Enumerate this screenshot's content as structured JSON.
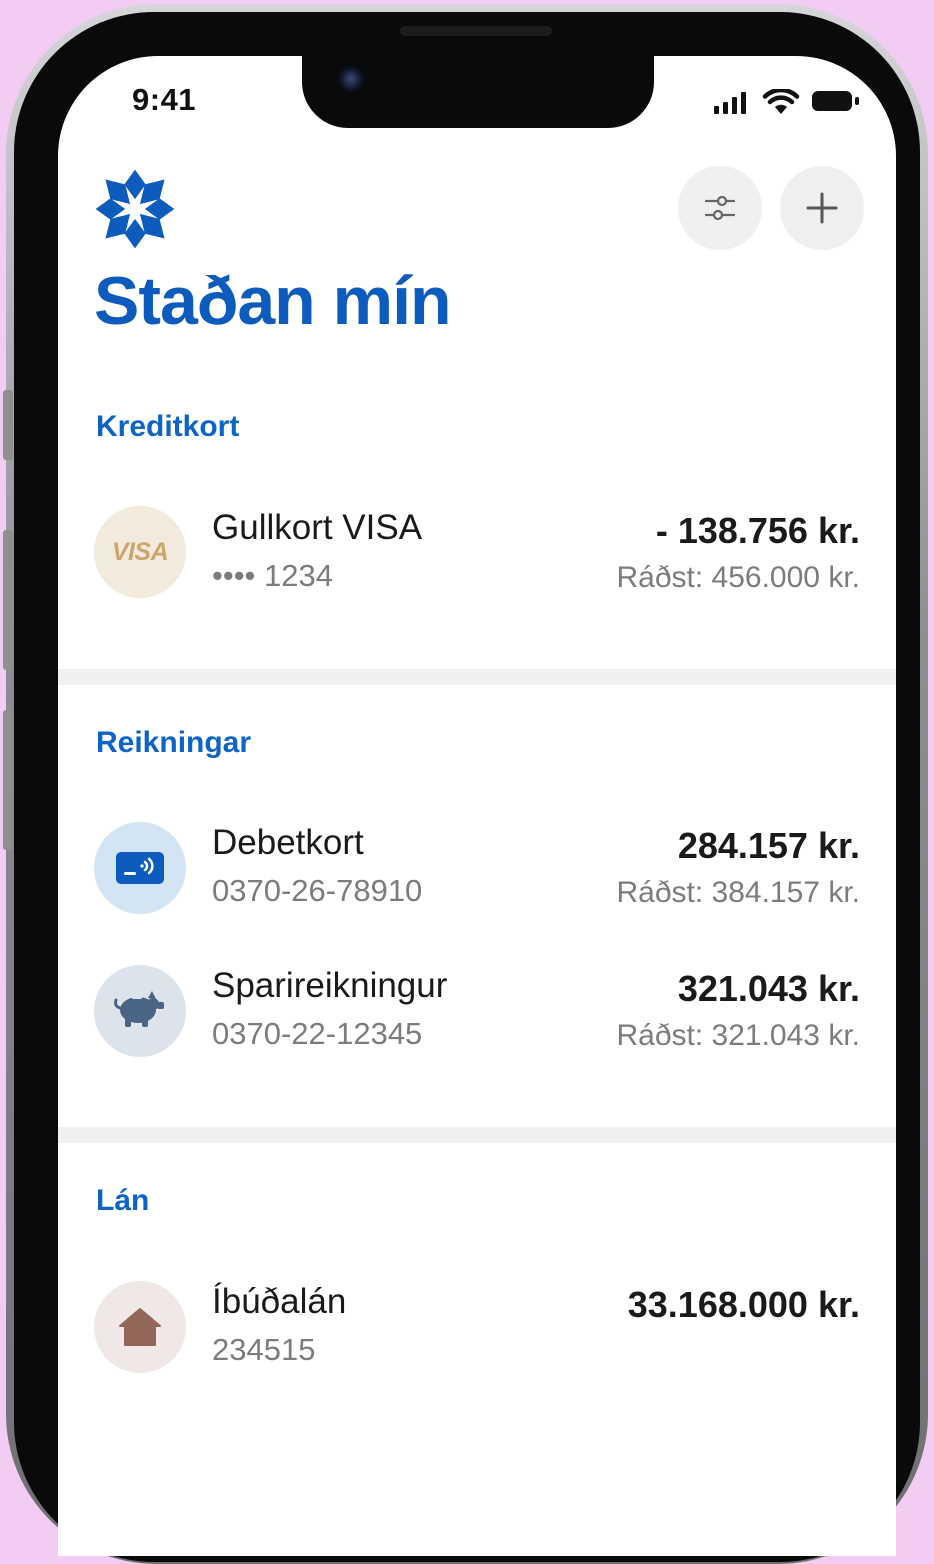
{
  "status_bar": {
    "time": "9:41"
  },
  "header": {
    "title": "Staðan mín",
    "filter_icon": "sliders-icon",
    "add_icon": "plus-icon"
  },
  "sections": {
    "credit_cards": {
      "title": "Kreditkort",
      "items": [
        {
          "name": "Gullkort VISA",
          "number": "•••• 1234",
          "amount": "- 138.756 kr.",
          "limit": "Ráðst: 456.000 kr.",
          "icon": "visa-icon",
          "icon_label": "VISA"
        }
      ]
    },
    "accounts": {
      "title": "Reikningar",
      "items": [
        {
          "name": "Debetkort",
          "number": "0370-26-78910",
          "amount": "284.157 kr.",
          "limit": "Ráðst: 384.157 kr.",
          "icon": "contactless-card-icon"
        },
        {
          "name": "Sparireikningur",
          "number": "0370-22-12345",
          "amount": "321.043 kr.",
          "limit": "Ráðst: 321.043 kr.",
          "icon": "piggy-bank-icon"
        }
      ]
    },
    "loans": {
      "title": "Lán",
      "items": [
        {
          "name": "Íbúðalán",
          "number": "234515",
          "amount": "33.168.000 kr.",
          "icon": "house-icon"
        }
      ]
    }
  },
  "colors": {
    "brand_blue": "#0d5cbd",
    "background": "#f2ccf2",
    "visa_bg": "#f2ebdd",
    "debit_bg": "#d3e4f5",
    "savings_bg": "#dde3ea",
    "loan_bg": "#f0e8e6"
  }
}
